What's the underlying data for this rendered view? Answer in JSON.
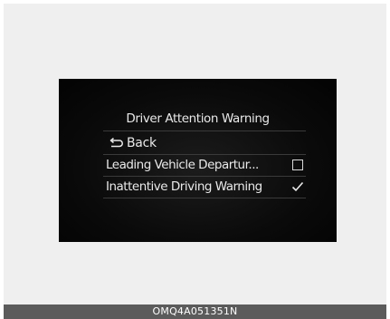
{
  "screen": {
    "title": "Driver Attention Warning",
    "back_label": "Back",
    "back_icon": "return-arrow-icon",
    "options": [
      {
        "label": "Leading Vehicle Departur...",
        "checked": false
      },
      {
        "label": "Inattentive Driving Warning",
        "checked": true
      }
    ]
  },
  "footer": {
    "code": "OMQ4A051351N"
  },
  "colors": {
    "screen_bg": "#050505",
    "text": "#e9e9e9",
    "frame_bg": "#efefef",
    "footer_bg": "#5b5b5b"
  }
}
